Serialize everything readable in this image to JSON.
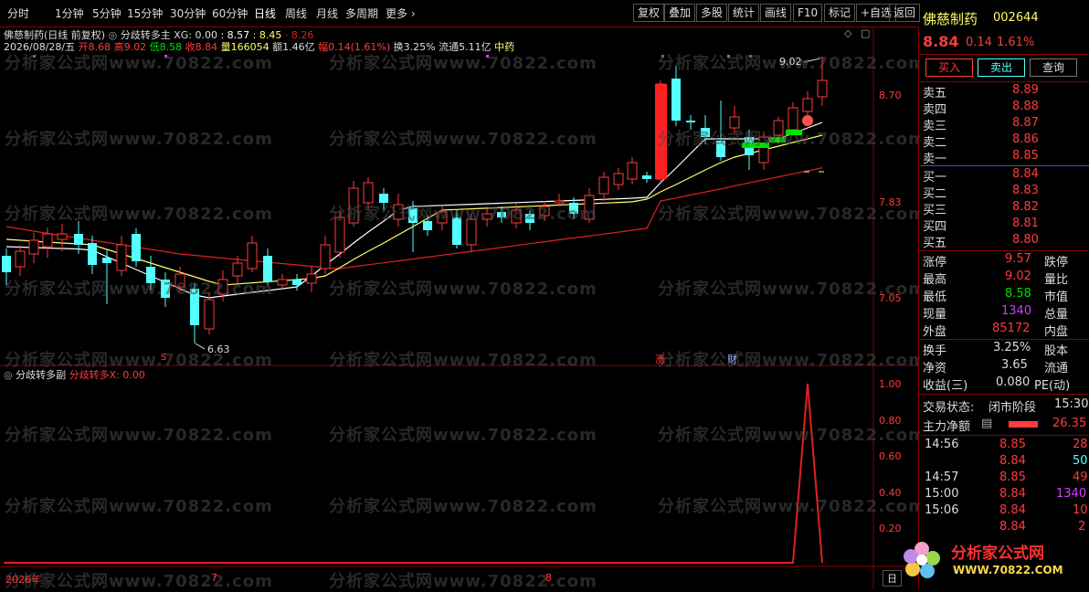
{
  "toolbar": {
    "left_items": [
      "分时",
      "1分钟",
      "5分钟",
      "15分钟",
      "30分钟",
      "60分钟",
      "日线",
      "周线",
      "月线",
      "多周期",
      "更多"
    ],
    "selected": "日线",
    "more_arrow": "chevron-right-icon",
    "right_items": [
      "复权",
      "叠加",
      "多股",
      "统计",
      "画线",
      "F10",
      "标记",
      "+自选",
      "返回"
    ]
  },
  "main_header": {
    "line1_stock": "佛慈制药",
    "line1_mode": "(日线 前复权)",
    "indicator_name": "分歧转多主",
    "xg_label": "XG: 0.00",
    "v1": ": 8.57",
    "v2": ": 8.45",
    "v3": "· 8.26",
    "date": "2026/08/28/五",
    "open_label": "开",
    "open": "8.68",
    "high_label": "高",
    "high": "9.02",
    "low_label": "低",
    "low": "8.58",
    "close_label": "收",
    "close": "8.84",
    "vol_label": "量",
    "vol": "166054",
    "amount_label": "额",
    "amount": "1.46亿",
    "change_label": "幅",
    "change": "0.14(1.61%)",
    "turnover": "换3.25%",
    "float": "流通5.11亿",
    "sector": "中药"
  },
  "price_axis": [
    "8.70",
    "7.83",
    "7.05"
  ],
  "chart_annotations": {
    "high_mark": "9.02",
    "low_mark": "6.63",
    "tag1": "S",
    "tag2": "涨",
    "tag3": "财"
  },
  "sub_header": {
    "name": "分歧转多副",
    "indicator": "分歧转多X: 0.00"
  },
  "sub_axis": [
    "1.00",
    "0.80",
    "0.60",
    "0.40",
    "0.20"
  ],
  "date_axis": [
    "2026年",
    "7",
    "8"
  ],
  "date_axis_btn": "日",
  "watermark": "分析家公式网www.70822.com",
  "right_panel": {
    "name": "佛慈制药",
    "code": "002644",
    "price": "8.84",
    "chg": "0.14",
    "pct": "1.61%",
    "buttons": [
      "买入",
      "卖出",
      "查询"
    ],
    "asks": [
      {
        "label": "卖五",
        "price": "8.89"
      },
      {
        "label": "卖四",
        "price": "8.88"
      },
      {
        "label": "卖三",
        "price": "8.87"
      },
      {
        "label": "卖二",
        "price": "8.86"
      },
      {
        "label": "卖一",
        "price": "8.85"
      }
    ],
    "bids": [
      {
        "label": "买一",
        "price": "8.84"
      },
      {
        "label": "买二",
        "price": "8.83"
      },
      {
        "label": "买三",
        "price": "8.82"
      },
      {
        "label": "买四",
        "price": "8.81"
      },
      {
        "label": "买五",
        "price": "8.80"
      }
    ],
    "stats": [
      {
        "k": "涨停",
        "v": "9.57",
        "k2": "跌停"
      },
      {
        "k": "最高",
        "v": "9.02",
        "k2": "量比"
      },
      {
        "k": "最低",
        "v": "8.58",
        "k2": "市值"
      },
      {
        "k": "现量",
        "v": "1340",
        "k2": "总量"
      },
      {
        "k": "外盘",
        "v": "85172",
        "k2": "内盘"
      }
    ],
    "stats2": [
      {
        "k": "换手",
        "v": "3.25%",
        "k2": "股本"
      },
      {
        "k": "净资",
        "v": "3.65",
        "k2": "流通"
      },
      {
        "k": "收益(三)",
        "v": "0.080",
        "k2": "PE(动)"
      }
    ],
    "status_label": "交易状态:",
    "status": "闭市阶段",
    "status_time": "15:30",
    "mainforce_label": "主力净额",
    "mainforce": "26.35",
    "ticks": [
      {
        "t": "14:56",
        "p": "8.85",
        "v": "28"
      },
      {
        "t": "",
        "p": "8.84",
        "v": "50"
      },
      {
        "t": "14:57",
        "p": "8.85",
        "v": "49"
      },
      {
        "t": "15:00",
        "p": "8.84",
        "v": "1340"
      },
      {
        "t": "15:06",
        "p": "8.84",
        "v": "10"
      },
      {
        "t": "",
        "p": "8.84",
        "v": "2"
      }
    ],
    "logo_text": "分析家公式网",
    "logo_url": "WWW.70822.COM"
  },
  "colors": {
    "up": "#ff3c3c",
    "down": "#54ffff",
    "grid": "#8a0000",
    "ma_white": "#ffffff",
    "ma_yellow": "#ffff66",
    "ma_red": "#e02020",
    "green": "#00e000",
    "purple": "#d040ff"
  }
}
